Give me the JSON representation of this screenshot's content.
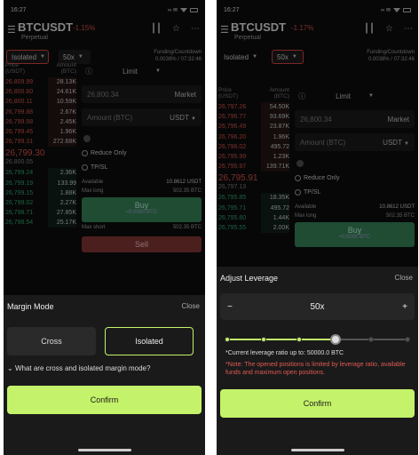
{
  "left": {
    "status": {
      "time": "16:27",
      "indicators": "∞ ✉"
    },
    "header": {
      "pair": "BTCUSDT",
      "change": "-1.15%",
      "product": "Perpetual"
    },
    "mode_select": "Isolated",
    "leverage_select": "50x",
    "funding": {
      "label": "Funding/Countdown",
      "value": "0.0038% / 07:32:46"
    },
    "book": {
      "price_head": "Price",
      "price_unit": "(USDT)",
      "amount_head": "Amount",
      "amount_unit": "(BTC)",
      "asks": [
        [
          "26,809.99",
          "28.13K"
        ],
        [
          "26,800.60",
          "24.61K"
        ],
        [
          "26,800.11",
          "10.59K"
        ],
        [
          "26,799.88",
          "2.67K"
        ],
        [
          "26,799.58",
          "2.45K"
        ],
        [
          "26,799.45",
          "1.96K"
        ],
        [
          "26,799.31",
          "272.68K"
        ]
      ],
      "last": "26,799.30",
      "last_sub": "26,800.05",
      "bids": [
        [
          "26,799.24",
          "2.36K"
        ],
        [
          "26,799.19",
          "133.99"
        ],
        [
          "26,799.15",
          "1.88K"
        ],
        [
          "26,799.02",
          "2.27K"
        ],
        [
          "26,798.71",
          "27.85K"
        ],
        [
          "26,798.54",
          "25.17K"
        ]
      ]
    },
    "form": {
      "order_type": "Limit",
      "price": "26,800.34",
      "market": "Market",
      "amount": "Amount (BTC)",
      "unit": "USDT",
      "reduce_only": "Reduce Only",
      "tpsl": "TP/SL",
      "available_label": "Available",
      "available": "10.8612 USDT",
      "max_long_label": "Max long",
      "max_long": "502.35 BTC",
      "buy": "Buy",
      "buy_sub": "≈0.0000 BTC",
      "max_short_label": "Max short",
      "max_short": "502.35 BTC",
      "sell": "Sell"
    },
    "sheet": {
      "title": "Margin Mode",
      "close": "Close",
      "cross": "Cross",
      "isolated": "Isolated",
      "faq": "What are cross and isolated margin mode?",
      "confirm": "Confirm"
    }
  },
  "right": {
    "status": {
      "time": "16:27",
      "indicators": "∞ ✉"
    },
    "header": {
      "pair": "BTCUSDT",
      "change": "-1.17%",
      "product": "Perpetual"
    },
    "mode_select": "Isolated",
    "leverage_select": "50x",
    "funding": {
      "label": "Funding/Countdown",
      "value": "0.0038% / 07:32:46"
    },
    "book": {
      "price_head": "Price",
      "price_unit": "(USDT)",
      "amount_head": "Amount",
      "amount_unit": "(BTC)",
      "asks": [
        [
          "26,797.26",
          "54.50K"
        ],
        [
          "26,796.77",
          "93.69K"
        ],
        [
          "26,796.49",
          "23.87K"
        ],
        [
          "26,796.20",
          "1.96K"
        ],
        [
          "26,796.02",
          "495.72"
        ],
        [
          "26,795.99",
          "1.23K"
        ],
        [
          "26,795.97",
          "139.71K"
        ]
      ],
      "last": "26,795.91",
      "last_sub": "26,797.13",
      "bids": [
        [
          "26,795.85",
          "18.35K"
        ],
        [
          "26,795.71",
          "495.72"
        ],
        [
          "26,795.60",
          "1.44K"
        ],
        [
          "26,795.55",
          "2.00K"
        ]
      ]
    },
    "form": {
      "order_type": "Limit",
      "price": "26,800.34",
      "market": "Market",
      "amount": "Amount (BTC)",
      "unit": "USDT",
      "reduce_only": "Reduce Only",
      "tpsl": "TP/SL",
      "available_label": "Available",
      "available": "10.8612 USDT",
      "max_long_label": "Max long",
      "max_long": "502.35 BTC",
      "buy": "Buy",
      "buy_sub": "≈0.0000 BTC"
    },
    "sheet": {
      "title": "Adjust Leverage",
      "close": "Close",
      "minus": "−",
      "value": "50x",
      "plus": "+",
      "slider_fraction": 0.6,
      "current": "*Current leverage ratio up to:  50000.0 BTC",
      "note": "*Note: The opened positions is limited by leverage ratio, available funds and maximum open positions.",
      "confirm": "Confirm"
    }
  },
  "colors": {
    "accent": "#c4f26a",
    "down": "#e05a52",
    "up": "#33b27a",
    "highlight": "#e64545"
  }
}
